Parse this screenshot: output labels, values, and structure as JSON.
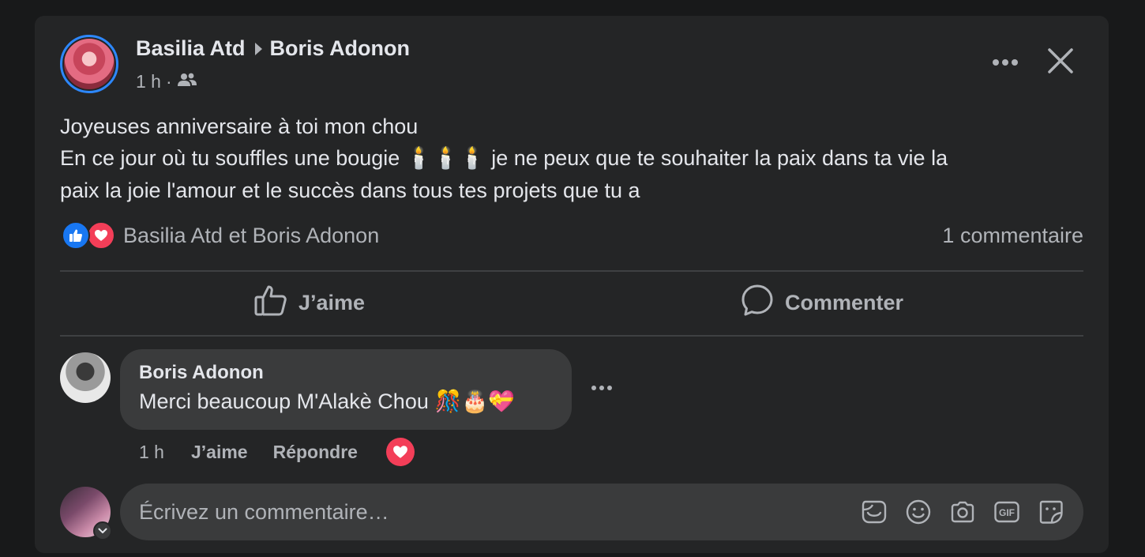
{
  "post": {
    "author": "Basilia Atd",
    "recipient": "Boris Adonon",
    "time": "1 h",
    "meta_separator": "·",
    "audience_icon": "friends-icon",
    "text_line1": "Joyeuses anniversaire à toi mon chou",
    "text_line2_before": "En ce jour où tu souffles une bougie",
    "candles": "🕯️🕯️🕯️",
    "text_line2_after": "je ne peux que te souhaiter la paix dans ta vie la",
    "text_line3": "paix la joie l'amour et le succès dans tous tes projets que tu a"
  },
  "reactions": {
    "names": "Basilia Atd et Boris Adonon",
    "comment_count": "1 commentaire",
    "icons": [
      "like-icon",
      "love-icon"
    ]
  },
  "actions": {
    "like_label": "J’aime",
    "comment_label": "Commenter"
  },
  "comment": {
    "author": "Boris Adonon",
    "text": "Merci beaucoup M'Alakè Chou",
    "emojis": "🎊🎂💝",
    "time": "1 h",
    "like_label": "J’aime",
    "reply_label": "Répondre"
  },
  "composer": {
    "placeholder": "Écrivez un commentaire…",
    "icons": [
      "avatar-sticker-icon",
      "emoji-icon",
      "camera-icon",
      "gif-icon",
      "sticker-icon"
    ],
    "gif_label": "GIF"
  },
  "colors": {
    "background": "#18191a",
    "card": "#242526",
    "bubble": "#3a3b3c",
    "primary_text": "#e4e6eb",
    "secondary_text": "#b0b3b8",
    "like_blue": "#1877f2",
    "love_red": "#f33e58",
    "avatar_ring": "#2d88ff"
  }
}
